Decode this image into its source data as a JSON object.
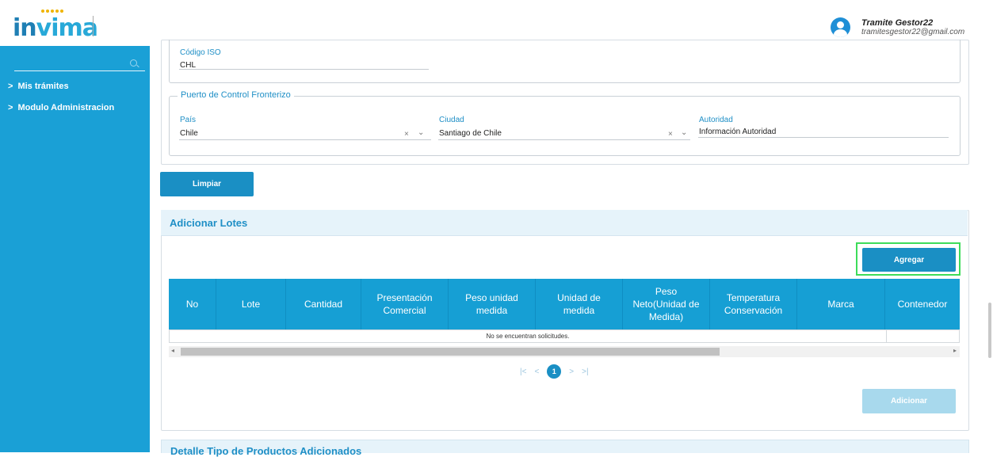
{
  "header": {
    "logo_left": "in",
    "logo_right": "vima",
    "user_name": "Tramite Gestor22",
    "user_email": "tramitesgestor22@gmail.com"
  },
  "sidebar": {
    "items": [
      {
        "label": "Mis trámites"
      },
      {
        "label": "Modulo Administracion"
      }
    ]
  },
  "form": {
    "iso": {
      "label": "Código ISO",
      "value": "CHL"
    },
    "border_control": {
      "legend": "Puerto de Control Fronterizo",
      "country": {
        "label": "País",
        "value": "Chile"
      },
      "city": {
        "label": "Ciudad",
        "value": "Santiago de Chile"
      },
      "authority": {
        "label": "Autoridad",
        "value": "Información Autoridad"
      }
    },
    "clear_label": "Limpiar"
  },
  "lots": {
    "title": "Adicionar Lotes",
    "add_label": "Agregar",
    "columns": [
      "No",
      "Lote",
      "Cantidad",
      "Presentación Comercial",
      "Peso unidad medida",
      "Unidad de medida",
      "Peso Neto(Unidad de Medida)",
      "Temperatura Conservación",
      "Marca",
      "Contenedor"
    ],
    "empty_text": "No se encuentran solicitudes.",
    "pager": {
      "first": "|<",
      "prev": "<",
      "current": "1",
      "next": ">",
      "last": ">|"
    },
    "submit_label": "Adicionar"
  },
  "next_section": {
    "title": "Detalle Tipo de Productos Adicionados"
  },
  "colors": {
    "sidebar": "#1aa0d6",
    "table_header": "#169fd4",
    "primary_button": "#1a8fc4",
    "highlight": "#3ddc5a"
  }
}
